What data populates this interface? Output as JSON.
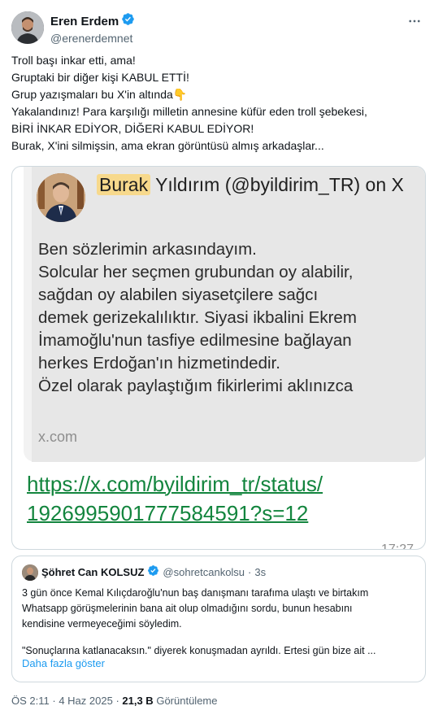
{
  "author": {
    "name": "Eren Erdem",
    "handle": "@erenerdemnet",
    "verified": true
  },
  "tweet": {
    "lines": [
      "Troll başı inkar etti, ama!",
      "Gruptaki bir diğer kişi KABUL ETTİ!",
      "Grup yazışmaları bu X'in altında👇",
      "Yakalandınız! Para karşılığı milletin annesine küfür eden troll şebekesi,",
      "BİRİ İNKAR EDİYOR, DİĞERİ KABUL EDİYOR!",
      "Burak, X'ini silmişsin, ama ekran görüntüsü almış arkadaşlar..."
    ]
  },
  "screenshot": {
    "title_highlight": "Burak",
    "title_rest": "Yıldırım (@byildirim_TR) on X",
    "body_lines": [
      "Ben sözlerimin arkasındayım.",
      "Solcular her seçmen grubundan oy alabilir,",
      "sağdan oy alabilen siyasetçilere sağcı",
      "demek gerizekalılıktır. Siyasi ikbalini Ekrem",
      "İmamoğlu'nun tasfiye edilmesine bağlayan",
      "herkes Erdoğan'ın hizmetindedir.",
      "Özel olarak paylaştığım fikirlerimi aklınızca"
    ],
    "domain": "x.com",
    "link_line1": "https://x.com/byildirim_tr/status/",
    "link_line2": "1926995901777584591?s=12",
    "time": "17:27"
  },
  "quote": {
    "name": "Şöhret Can KOLSUZ",
    "handle": "@sohretcankolsu",
    "time": "3s",
    "lines": [
      "3 gün önce Kemal Kılıçdaroğlu'nun baş danışmanı tarafıma ulaştı ve birtakım",
      "Whatsapp görüşmelerinin bana ait olup olmadığını sordu, bunun hesabını",
      "kendisine vermeyeceğimi söyledim.",
      "",
      "\"Sonuçlarına katlanacaksın.\" diyerek konuşmadan ayrıldı. Ertesi gün bize ait ..."
    ],
    "show_more": "Daha fazla göster"
  },
  "footer": {
    "time": "ÖS 2:11",
    "date": "4 Haz 2025",
    "views_count": "21,3 B",
    "views_label": "Görüntüleme"
  },
  "colors": {
    "verified": "#1d9bf0",
    "link_green": "#13853e",
    "highlight": "#f7d98c"
  }
}
